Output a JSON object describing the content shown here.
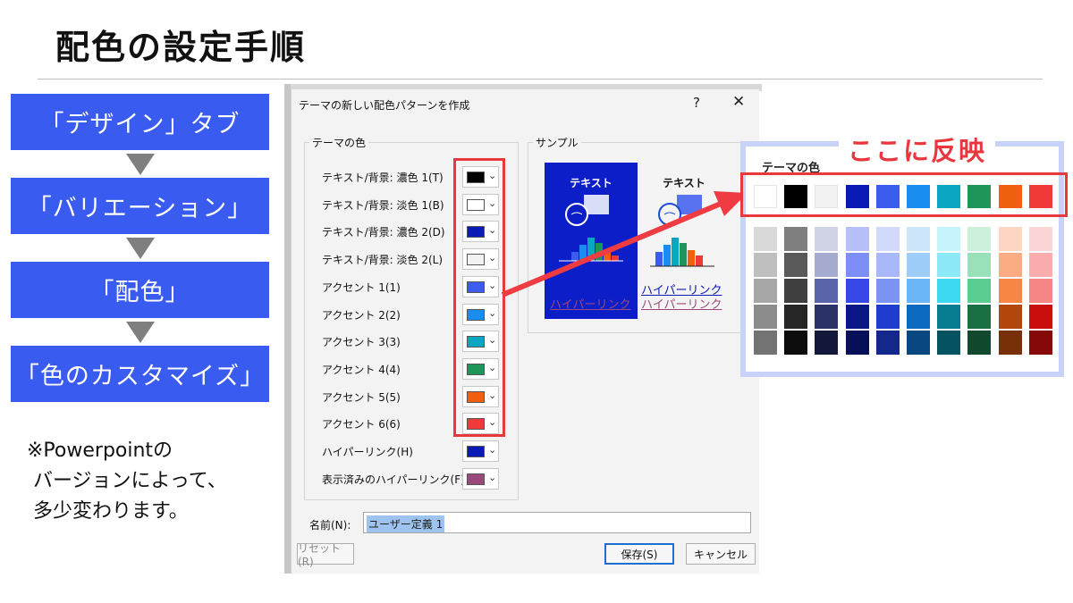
{
  "slide": {
    "title": "配色の設定手順",
    "steps": [
      "「デザイン」タブ",
      "「バリエーション」",
      "「配色」",
      "「色のカスタマイズ」"
    ],
    "note_lines": [
      "※Powerpointの",
      " バージョンによって、",
      " 多少変わります。"
    ]
  },
  "dialog": {
    "title": "テーマの新しい配色パターンを作成",
    "help": "?",
    "close": "✕",
    "theme_group_label": "テーマの色",
    "sample_group_label": "サンプル",
    "rows": [
      {
        "label": "テキスト/背景: 濃色 1(T)",
        "color": "#000000"
      },
      {
        "label": "テキスト/背景: 淡色 1(B)",
        "color": "#ffffff"
      },
      {
        "label": "テキスト/背景: 濃色 2(D)",
        "color": "#0a1ab4"
      },
      {
        "label": "テキスト/背景: 淡色 2(L)",
        "color": "#f2f2f2"
      },
      {
        "label": "アクセント 1(1)",
        "color": "#3c5cf0"
      },
      {
        "label": "アクセント 2(2)",
        "color": "#1a8ef0"
      },
      {
        "label": "アクセント 3(3)",
        "color": "#0aa6c2"
      },
      {
        "label": "アクセント 4(4)",
        "color": "#20955a"
      },
      {
        "label": "アクセント 5(5)",
        "color": "#f06010"
      },
      {
        "label": "アクセント 6(6)",
        "color": "#f03a3a"
      },
      {
        "label": "ハイパーリンク(H)",
        "color": "#0a1ab4"
      },
      {
        "label": "表示済みのハイパーリンク(F)",
        "color": "#9a4a7a"
      }
    ],
    "sample": {
      "text_label": "テキスト",
      "hyperlink": "ハイパーリンク",
      "visited_hyperlink": "ハイパーリンク"
    },
    "name_label": "名前(N):",
    "name_value": "ユーザー定義 1",
    "reset_label": "リセット(R)",
    "save_label": "保存(S)",
    "cancel_label": "キャンセル"
  },
  "callout": {
    "title": "ここに反映",
    "palette_label": "テーマの色",
    "theme_colors": [
      "#ffffff",
      "#000000",
      "#f2f2f2",
      "#0a1ab4",
      "#3c5cf0",
      "#1a8ef0",
      "#0aa6c2",
      "#20955a",
      "#f06010",
      "#f03a3a"
    ],
    "shades": [
      [
        "#d9d9d9",
        "#bfbfbf",
        "#a6a6a6",
        "#8c8c8c",
        "#737373"
      ],
      [
        "#7f7f7f",
        "#595959",
        "#404040",
        "#262626",
        "#0d0d0d"
      ],
      [
        "#d0d3e6",
        "#a6acd0",
        "#5a64a8",
        "#2b3366",
        "#13183a"
      ],
      [
        "#b8c0fb",
        "#7d8ef6",
        "#3748e8",
        "#0b1687",
        "#070f58"
      ],
      [
        "#d2dafc",
        "#a8b8f9",
        "#7c95f5",
        "#1f3bd0",
        "#14288c"
      ],
      [
        "#cde6fc",
        "#9ccef9",
        "#6bb5f6",
        "#0c6bc0",
        "#084780"
      ],
      [
        "#c6f4fc",
        "#8de9f8",
        "#3cd9f1",
        "#087c91",
        "#055261"
      ],
      [
        "#cbf0dc",
        "#98e1b9",
        "#5ccd91",
        "#187043",
        "#10492d"
      ],
      [
        "#fdd5c0",
        "#fbac82",
        "#f78543",
        "#b3470b",
        "#773007"
      ],
      [
        "#fcd6d6",
        "#f9adad",
        "#f68585",
        "#c90e0e",
        "#860909"
      ]
    ]
  }
}
